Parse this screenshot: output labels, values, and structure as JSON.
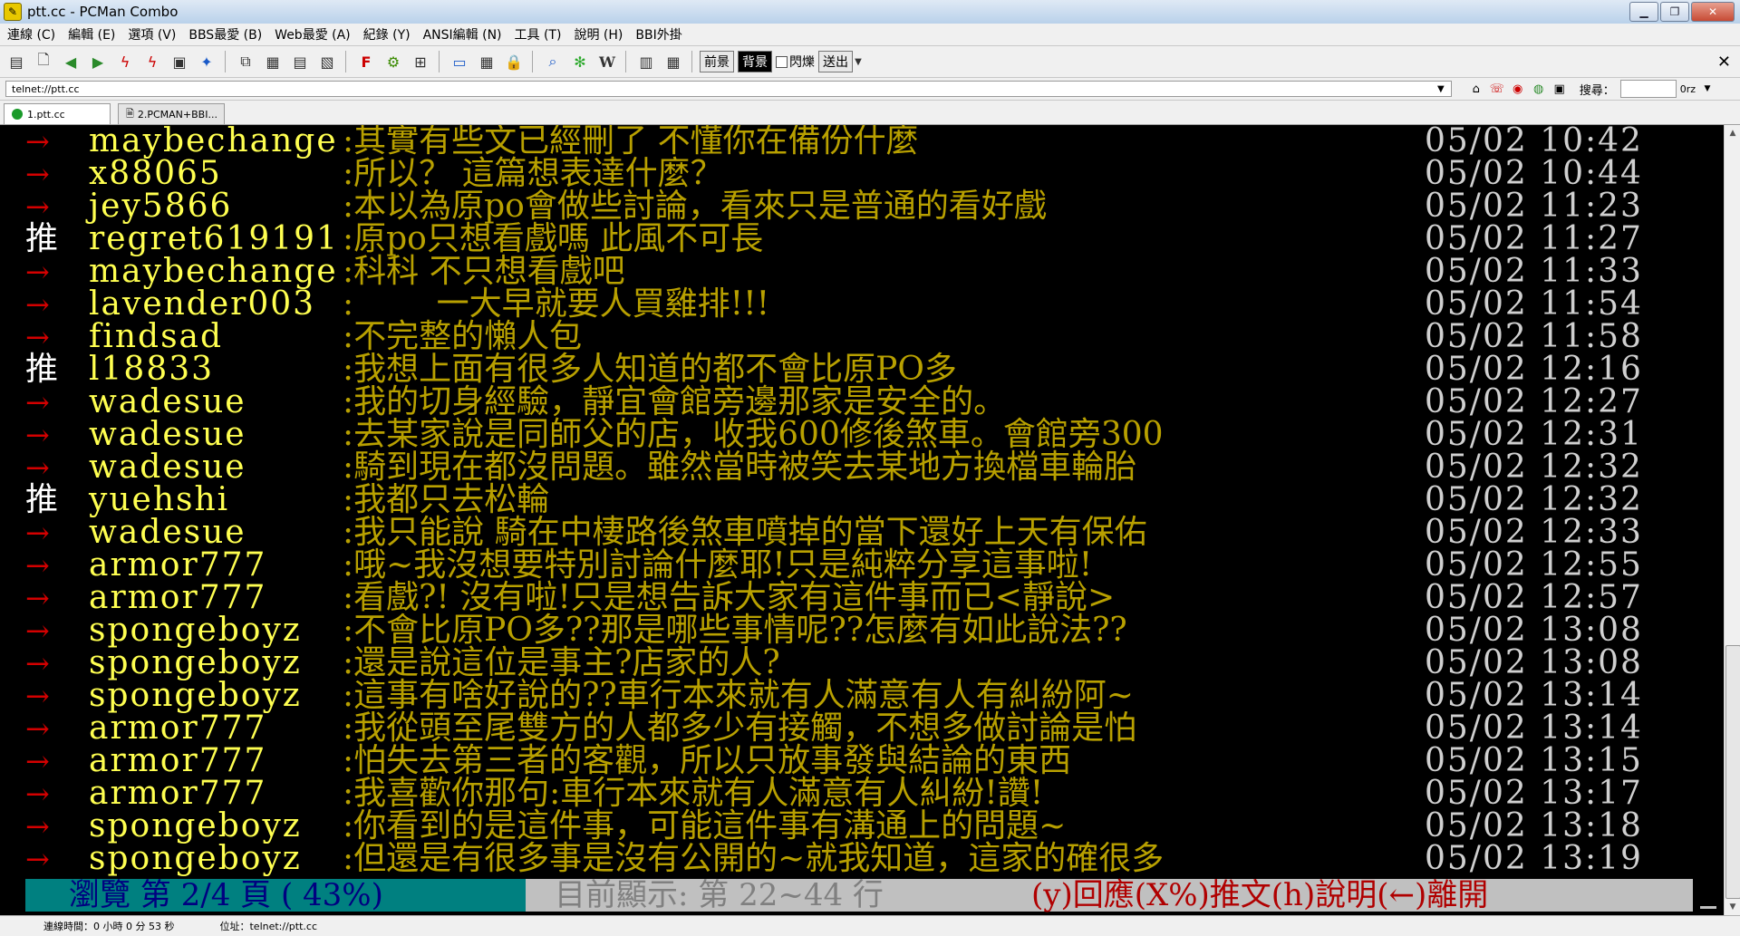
{
  "window": {
    "title": "ptt.cc - PCMan Combo",
    "app_icon": "pcman-icon"
  },
  "menu": [
    "連線 (C)",
    "編輯 (E)",
    "選項 (V)",
    "BBS最愛 (B)",
    "Web最愛 (A)",
    "紀錄 (Y)",
    "ANSI編輯 (N)",
    "工具 (T)",
    "說明 (H)",
    "BBI外掛"
  ],
  "toolbar": {
    "foreground_label": "前景",
    "background_label": "背景",
    "blink_label": "閃爍",
    "send_label": "送出"
  },
  "address": {
    "value": "telnet://ptt.cc",
    "search_label": "搜尋：",
    "search_extra": "0rz"
  },
  "tabs": [
    {
      "label": "1.ptt.cc"
    },
    {
      "label": "2.PCMAN+BBI..."
    }
  ],
  "comments": [
    {
      "mark": "→",
      "user": "maybechange",
      "msg": ":其實有些文已經刪了 不懂你在備份什麼",
      "time": "05/02 10:42"
    },
    {
      "mark": "→",
      "user": "x88065",
      "msg": ":所以？  這篇想表達什麼？",
      "time": "05/02 10:44"
    },
    {
      "mark": "→",
      "user": "jey5866",
      "msg": ":本以為原po會做些討論，看來只是普通的看好戲",
      "time": "05/02 11:23"
    },
    {
      "mark": "推",
      "user": "regret619191",
      "msg": ":原po只想看戲嗎   此風不可長",
      "time": "05/02 11:27"
    },
    {
      "mark": "→",
      "user": "maybechange",
      "msg": ":科科 不只想看戲吧",
      "time": "05/02 11:33"
    },
    {
      "mark": "→",
      "user": "lavender003",
      "msg": ":        一大早就要人買雞排!!!",
      "time": "05/02 11:54"
    },
    {
      "mark": "→",
      "user": "findsad",
      "msg": ":不完整的懶人包",
      "time": "05/02 11:58"
    },
    {
      "mark": "推",
      "user": "l18833",
      "msg": ":我想上面有很多人知道的都不會比原PO多",
      "time": "05/02 12:16"
    },
    {
      "mark": "→",
      "user": "wadesue",
      "msg": ":我的切身經驗，靜宜會館旁邊那家是安全的。",
      "time": "05/02 12:27"
    },
    {
      "mark": "→",
      "user": "wadesue",
      "msg": ":去某家說是同師父的店，收我600修後煞車。會館旁300",
      "time": "05/02 12:31"
    },
    {
      "mark": "→",
      "user": "wadesue",
      "msg": ":騎到現在都沒問題。雖然當時被笑去某地方換檔車輪胎",
      "time": "05/02 12:32"
    },
    {
      "mark": "推",
      "user": "yuehshi",
      "msg": ":我都只去松輪",
      "time": "05/02 12:32"
    },
    {
      "mark": "→",
      "user": "wadesue",
      "msg": ":我只能說 騎在中棲路後煞車噴掉的當下還好上天有保佑",
      "time": "05/02 12:33"
    },
    {
      "mark": "→",
      "user": "armor777",
      "msg": ":哦~我沒想要特別討論什麼耶!只是純粹分享這事啦!",
      "time": "05/02 12:55"
    },
    {
      "mark": "→",
      "user": "armor777",
      "msg": ":看戲?! 沒有啦!只是想告訴大家有這件事而已<靜說>",
      "time": "05/02 12:57"
    },
    {
      "mark": "→",
      "user": "spongeboyz",
      "msg": ":不會比原PO多??那是哪些事情呢??怎麼有如此說法??",
      "time": "05/02 13:08"
    },
    {
      "mark": "→",
      "user": "spongeboyz",
      "msg": ":還是說這位是事主?店家的人?",
      "time": "05/02 13:08"
    },
    {
      "mark": "→",
      "user": "spongeboyz",
      "msg": ":這事有啥好說的??車行本來就有人滿意有人有糾紛阿~",
      "time": "05/02 13:14"
    },
    {
      "mark": "→",
      "user": "armor777",
      "msg": ":我從頭至尾雙方的人都多少有接觸，不想多做討論是怕",
      "time": "05/02 13:14"
    },
    {
      "mark": "→",
      "user": "armor777",
      "msg": ":怕失去第三者的客觀，所以只放事發與結論的東西",
      "time": "05/02 13:15"
    },
    {
      "mark": "→",
      "user": "armor777",
      "msg": ":我喜歡你那句:車行本來就有人滿意有人糾紛!讚!",
      "time": "05/02 13:17"
    },
    {
      "mark": "→",
      "user": "spongeboyz",
      "msg": ":你看到的是這件事，可能這件事有溝通上的問題~",
      "time": "05/02 13:18"
    },
    {
      "mark": "→",
      "user": "spongeboyz",
      "msg": ":但還是有很多事是沒有公開的~就我知道，這家的確很多",
      "time": "05/02 13:19"
    }
  ],
  "status": {
    "browse": "瀏覽 第 2/4 頁 ( 43%)",
    "display": "目前顯示: 第 22~44 行",
    "keys": "(y)回應(X%)推文(h)說明(←)離開"
  },
  "statusbar": {
    "conn_time": "連線時間：0 小時 0 分 53 秒",
    "location": "位址：telnet://ptt.cc"
  },
  "scroll": {
    "position_fraction": 0.72
  }
}
